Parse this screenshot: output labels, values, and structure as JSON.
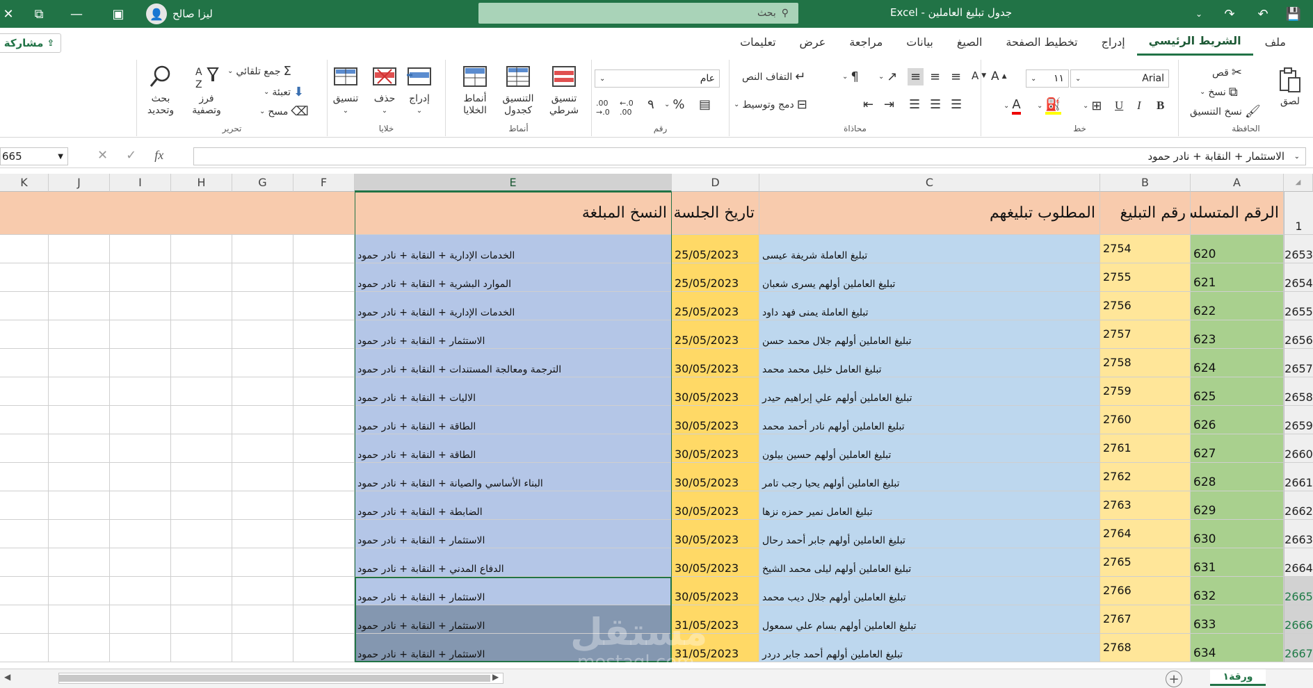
{
  "titlebar": {
    "doc_title": "جدول تبليغ العاملين - Excel",
    "search_label": "بحث",
    "user_name": "ليزا صالح"
  },
  "menu": {
    "tabs": [
      "ملف",
      "الشريط الرئيسي",
      "إدراج",
      "تخطيط الصفحة",
      "الصيغ",
      "بيانات",
      "مراجعة",
      "عرض",
      "تعليمات"
    ],
    "share_label": "مشاركة"
  },
  "ribbon": {
    "clipboard": {
      "label": "الحافظة",
      "paste": "لصق",
      "cut": "قص",
      "copy": "نسخ",
      "format_painter": "نسخ التنسيق"
    },
    "font": {
      "label": "خط",
      "font_name": "Arial",
      "font_size": "١١",
      "bold": "B",
      "italic": "I",
      "underline": "U"
    },
    "alignment": {
      "label": "محاذاة",
      "wrap_text": "التفاف النص",
      "merge_center": "دمج وتوسيط"
    },
    "number": {
      "label": "رقم",
      "format": "عام",
      "percent": "%",
      "comma": "٩"
    },
    "styles": {
      "label": "أنماط",
      "conditional": "تنسيق شرطي",
      "as_table": "التنسيق كجدول",
      "cell_styles": "أنماط الخلايا"
    },
    "cells": {
      "label": "خلايا",
      "insert": "إدراج",
      "delete": "حذف",
      "format": "تنسيق"
    },
    "editing": {
      "label": "تحرير",
      "autosum": "جمع تلقائي",
      "fill": "تعبئة",
      "clear": "مسح",
      "sort_filter": "فرز وتصفية",
      "find_select": "بحث وتحديد"
    }
  },
  "formula_bar": {
    "name_box": "665",
    "fx": "fx",
    "content": "الاستثمار + النقابة + نادر حمود"
  },
  "columns": [
    "A",
    "B",
    "C",
    "D",
    "E",
    "F",
    "G",
    "H",
    "I",
    "J",
    "K"
  ],
  "header_row": {
    "row_number": "1",
    "A": "الرقم المتسلسل",
    "B": "رقم التبليغ",
    "C": "المطلوب تبليغهم",
    "D": "تاريخ الجلسة",
    "E": "النسخ المبلغة"
  },
  "rows": [
    {
      "n": "2653",
      "a": "620",
      "b": "2754",
      "c": "تبليغ العاملة شريفة عيسى",
      "d": "25/05/2023",
      "e": "الخدمات الإدارية + النقابة + نادر حمود"
    },
    {
      "n": "2654",
      "a": "621",
      "b": "2755",
      "c": "تبليغ العاملين أولهم يسرى شعبان",
      "d": "25/05/2023",
      "e": "الموارد البشرية + النقابة + نادر حمود"
    },
    {
      "n": "2655",
      "a": "622",
      "b": "2756",
      "c": "تبليغ العاملة يمنى فهد داود",
      "d": "25/05/2023",
      "e": "الخدمات الإدارية + النقابة + نادر حمود"
    },
    {
      "n": "2656",
      "a": "623",
      "b": "2757",
      "c": "تبليغ العاملين أولهم جلال محمد حسن",
      "d": "25/05/2023",
      "e": "الاستثمار + النقابة + نادر حمود"
    },
    {
      "n": "2657",
      "a": "624",
      "b": "2758",
      "c": "تبليغ العامل خليل محمد محمد",
      "d": "30/05/2023",
      "e": "الترجمة ومعالجة المستندات + النقابة + نادر حمود"
    },
    {
      "n": "2658",
      "a": "625",
      "b": "2759",
      "c": "تبليغ العاملين أولهم علي إبراهيم حيدر",
      "d": "30/05/2023",
      "e": "الاليات + النقابة + نادر حمود"
    },
    {
      "n": "2659",
      "a": "626",
      "b": "2760",
      "c": "تبليغ العاملين أولهم نادر أحمد محمد",
      "d": "30/05/2023",
      "e": "الطاقة + النقابة + نادر حمود"
    },
    {
      "n": "2660",
      "a": "627",
      "b": "2761",
      "c": "تبليغ العاملين أولهم حسين بيلون",
      "d": "30/05/2023",
      "e": "الطاقة + النقابة + نادر حمود"
    },
    {
      "n": "2661",
      "a": "628",
      "b": "2762",
      "c": "تبليغ العاملين أولهم يحيا رجب تامر",
      "d": "30/05/2023",
      "e": "البناء الأساسي والصيانة + النقابة + نادر حمود"
    },
    {
      "n": "2662",
      "a": "629",
      "b": "2763",
      "c": "تبليغ العامل نمير حمزه نزها",
      "d": "30/05/2023",
      "e": "الضابطة + النقابة + نادر حمود"
    },
    {
      "n": "2663",
      "a": "630",
      "b": "2764",
      "c": "تبليغ العاملين أولهم جابر أحمد رحال",
      "d": "30/05/2023",
      "e": "الاستثمار + النقابة + نادر حمود"
    },
    {
      "n": "2664",
      "a": "631",
      "b": "2765",
      "c": "تبليغ العاملين أولهم ليلى محمد الشيخ",
      "d": "30/05/2023",
      "e": "الدفاع المدني + النقابة + نادر حمود"
    },
    {
      "n": "2665",
      "a": "632",
      "b": "2766",
      "c": "تبليغ العاملين أولهم جلال ديب محمد",
      "d": "30/05/2023",
      "e": "الاستثمار + النقابة + نادر حمود"
    },
    {
      "n": "2666",
      "a": "633",
      "b": "2767",
      "c": "تبليغ العاملين أولهم بسام علي سمعول",
      "d": "31/05/2023",
      "e": "الاستثمار + النقابة + نادر حمود"
    },
    {
      "n": "2667",
      "a": "634",
      "b": "2768",
      "c": "تبليغ العاملين أولهم أحمد جابر دردر",
      "d": "31/05/2023",
      "e": "الاستثمار + النقابة + نادر حمود"
    }
  ],
  "sheet": {
    "tab": "ورقة١"
  },
  "watermark": {
    "main": "مستقل",
    "sub": "mostaql.com"
  },
  "colors": {
    "excel_green": "#217346",
    "header_fill": "#f8cbad",
    "col_a": "#a9d08e",
    "col_b": "#ffe699",
    "col_c": "#bdd7ee",
    "col_d": "#ffd966",
    "col_e": "#b4c6e7",
    "col_e_dark": "#8497b0"
  }
}
